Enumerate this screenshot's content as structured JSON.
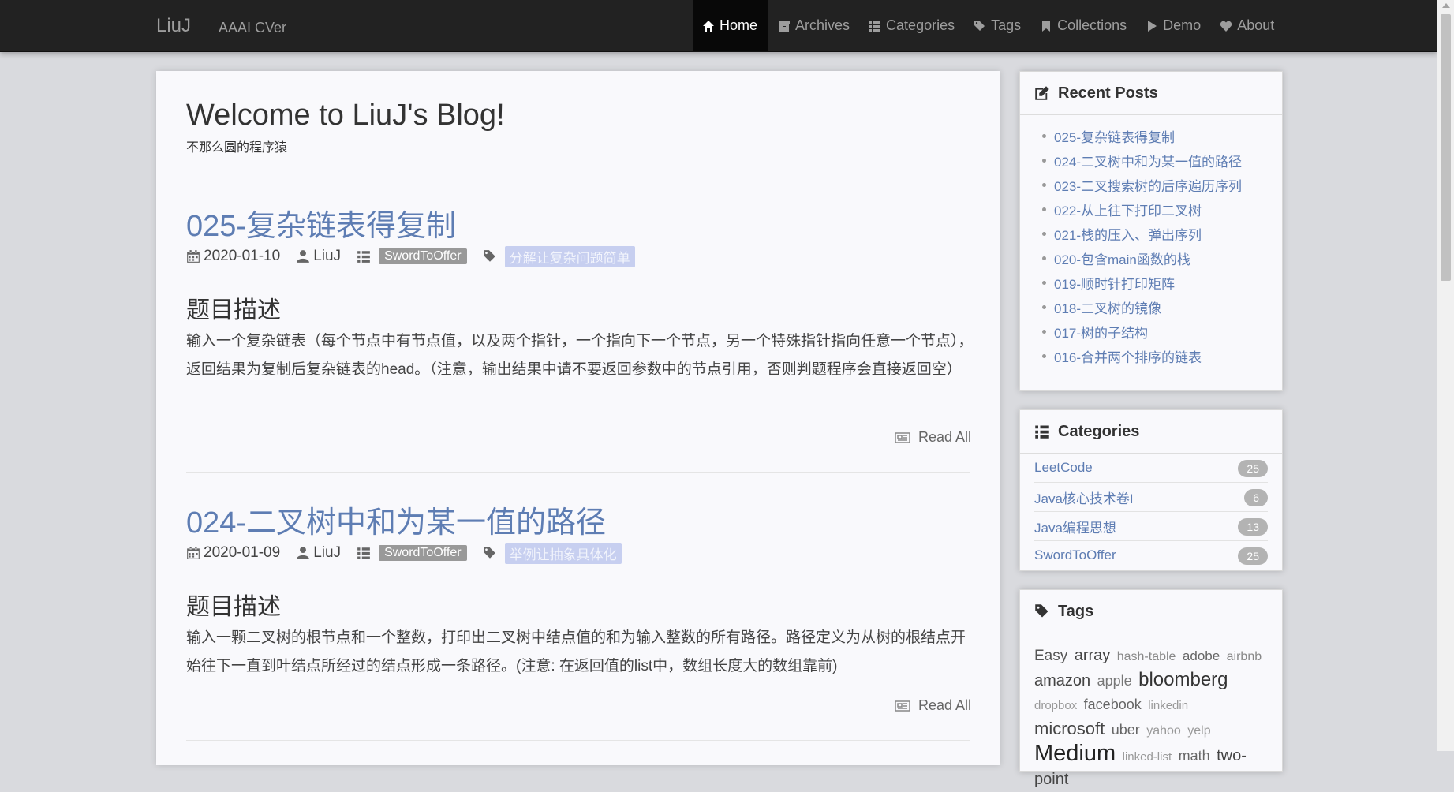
{
  "navbar": {
    "brand": "LiuJ",
    "subtitle": "AAAI CVer",
    "items": [
      {
        "label": "Home",
        "icon": "home-icon"
      },
      {
        "label": "Archives",
        "icon": "archive-icon"
      },
      {
        "label": "Categories",
        "icon": "list-icon"
      },
      {
        "label": "Tags",
        "icon": "tags-icon"
      },
      {
        "label": "Collections",
        "icon": "bookmark-icon"
      },
      {
        "label": "Demo",
        "icon": "play-icon"
      },
      {
        "label": "About",
        "icon": "heart-icon"
      }
    ]
  },
  "main": {
    "welcome": "Welcome to LiuJ's Blog!",
    "tagline": "不那么圆的程序猿",
    "posts": [
      {
        "title": "025-复杂链表得复制",
        "date": "2020-01-10",
        "author": "LiuJ",
        "category": "SwordToOffer",
        "tag": "分解让复杂问题简单",
        "section": "题目描述",
        "body": "输入一个复杂链表（每个节点中有节点值，以及两个指针，一个指向下一个节点，另一个特殊指针指向任意一个节点），返回结果为复制后复杂链表的head。（注意，输出结果中请不要返回参数中的节点引用，否则判题程序会直接返回空）",
        "read_all": "Read All"
      },
      {
        "title": "024-二叉树中和为某一值的路径",
        "date": "2020-01-09",
        "author": "LiuJ",
        "category": "SwordToOffer",
        "tag": "举例让抽象具体化",
        "section": "题目描述",
        "body": "输入一颗二叉树的根节点和一个整数，打印出二叉树中结点值的和为输入整数的所有路径。路径定义为从树的根结点开始往下一直到叶结点所经过的结点形成一条路径。(注意: 在返回值的list中，数组长度大的数组靠前)",
        "read_all": "Read All"
      }
    ]
  },
  "sidebar": {
    "recent_title": "Recent Posts",
    "recent_posts": [
      "025-复杂链表得复制",
      "024-二叉树中和为某一值的路径",
      "023-二叉搜索树的后序遍历序列",
      "022-从上往下打印二叉树",
      "021-栈的压入、弹出序列",
      "020-包含main函数的栈",
      "019-顺时针打印矩阵",
      "018-二叉树的镜像",
      "017-树的子结构",
      "016-合并两个排序的链表"
    ],
    "categories_title": "Categories",
    "categories": [
      {
        "name": "LeetCode",
        "count": "25"
      },
      {
        "name": "Java核心技术卷I",
        "count": "6"
      },
      {
        "name": "Java编程思想",
        "count": "13"
      },
      {
        "name": "SwordToOffer",
        "count": "25"
      }
    ],
    "tags_title": "Tags",
    "tags": [
      "Easy",
      "array",
      "hash-table",
      "adobe",
      "airbnb",
      "amazon",
      "apple",
      "bloomberg",
      "dropbox",
      "facebook",
      "linkedin",
      "microsoft",
      "uber",
      "yahoo",
      "yelp",
      "Medium",
      "linked-list",
      "math",
      "two-point"
    ]
  },
  "colors": {
    "link": "#5e7db3",
    "navbar": "#222222",
    "category_label": "#999999",
    "tag_label": "#c7cff0"
  }
}
